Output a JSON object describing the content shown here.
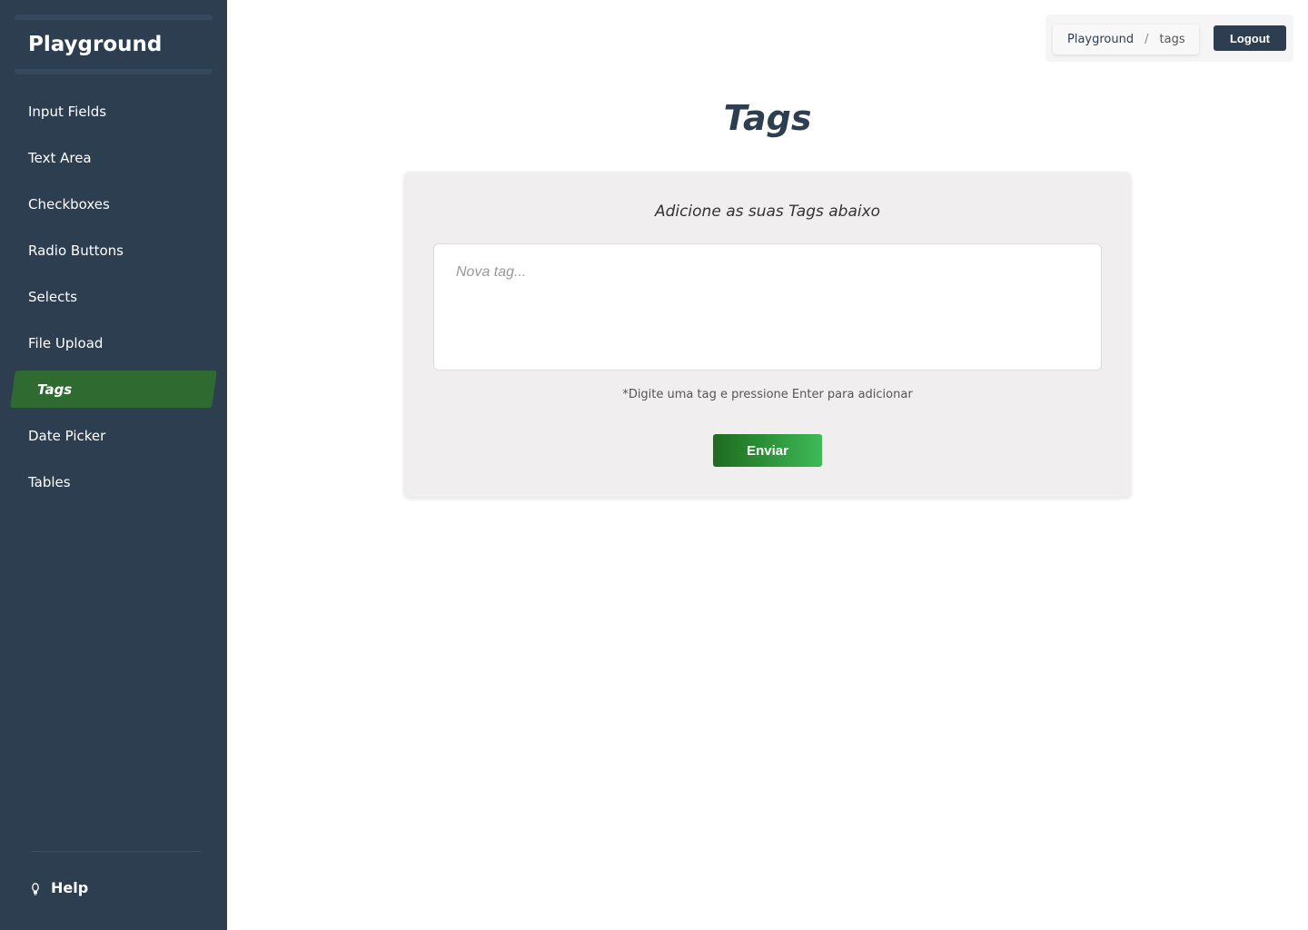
{
  "sidebar": {
    "brand": "Playground",
    "items": [
      {
        "label": "Input Fields"
      },
      {
        "label": "Text Area"
      },
      {
        "label": "Checkboxes"
      },
      {
        "label": "Radio Buttons"
      },
      {
        "label": "Selects"
      },
      {
        "label": "File Upload"
      },
      {
        "label": "Tags"
      },
      {
        "label": "Date Picker"
      },
      {
        "label": "Tables"
      }
    ],
    "active_item": "Tags",
    "help_label": "Help",
    "help_icon": "lightbulb-icon"
  },
  "header": {
    "breadcrumb": {
      "root": "Playground",
      "separator": "/",
      "current": "tags"
    },
    "logout_label": "Logout"
  },
  "main": {
    "title": "Tags",
    "card": {
      "subtitle": "Adicione as suas Tags abaixo",
      "input_placeholder": "Nova tag...",
      "input_value": "",
      "hint": "*Digite uma tag e pressione Enter para adicionar",
      "submit_label": "Enviar"
    }
  },
  "colors": {
    "sidebar_bg": "#2c3e50",
    "active_item_bg": "#2f6a30",
    "accent_green_start": "#1f6a1f",
    "accent_green_end": "#3dba55",
    "card_bg": "#f0eeee"
  }
}
